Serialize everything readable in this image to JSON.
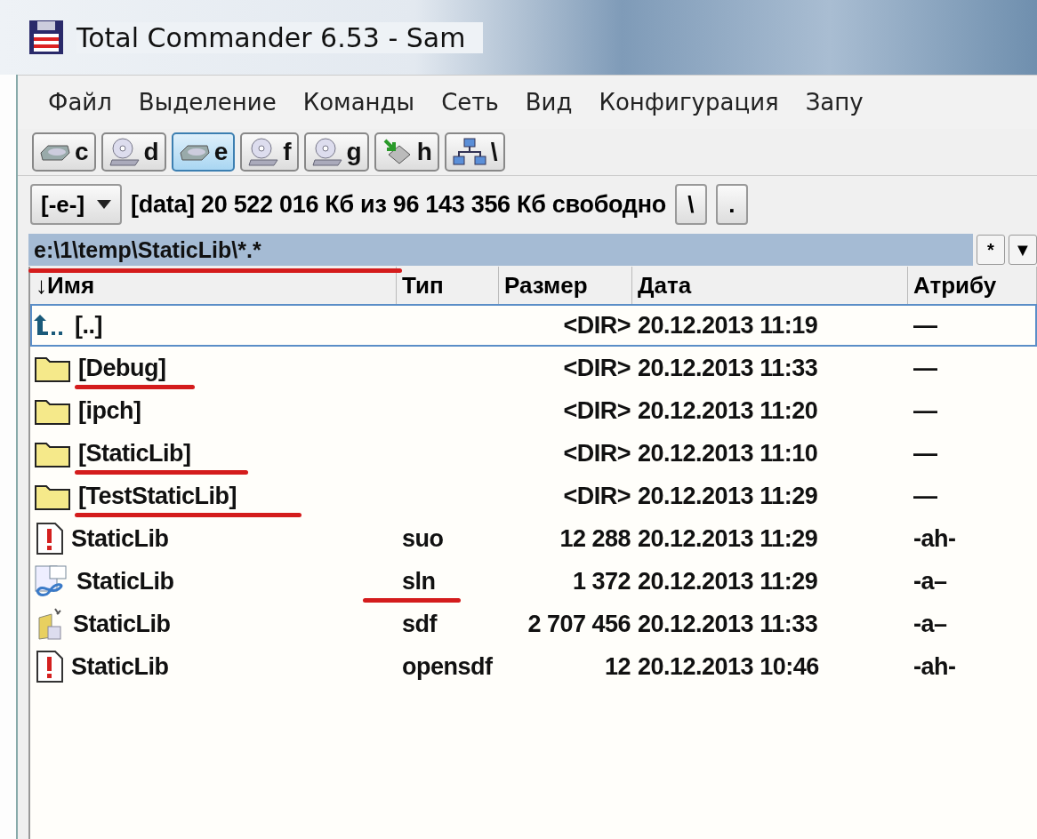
{
  "window": {
    "title": "Total Commander 6.53 - Sam"
  },
  "menu": [
    "Файл",
    "Выделение",
    "Команды",
    "Сеть",
    "Вид",
    "Конфигурация",
    "Запу"
  ],
  "drives": [
    {
      "letter": "c",
      "kind": "disk",
      "selected": false
    },
    {
      "letter": "d",
      "kind": "cd",
      "selected": false
    },
    {
      "letter": "e",
      "kind": "disk",
      "selected": true
    },
    {
      "letter": "f",
      "kind": "cd",
      "selected": false
    },
    {
      "letter": "g",
      "kind": "cd",
      "selected": false
    },
    {
      "letter": "h",
      "kind": "usb",
      "selected": false
    },
    {
      "letter": "\\",
      "kind": "network",
      "selected": false
    }
  ],
  "drive_info": {
    "drive": "[-e-]",
    "text": "[data]  20 522 016 Кб из 96 143 356 Кб свободно",
    "buttons": [
      "\\",
      "."
    ]
  },
  "path": {
    "text": "e:\\1\\temp\\StaticLib\\*.*",
    "annotated": true,
    "buttons": [
      "*",
      "▼"
    ]
  },
  "columns": [
    "↓Имя",
    "Тип",
    "Размер",
    "Дата",
    "Атрибу"
  ],
  "rows": [
    {
      "kind": "up",
      "name": "[..]",
      "type": "",
      "size": "<DIR>",
      "date": "20.12.2013 11:19",
      "attr": "—",
      "selected": true,
      "annotated": false
    },
    {
      "kind": "folder",
      "name": "[Debug]",
      "type": "",
      "size": "<DIR>",
      "date": "20.12.2013 11:33",
      "attr": "—",
      "selected": false,
      "annotated": true
    },
    {
      "kind": "folder",
      "name": "[ipch]",
      "type": "",
      "size": "<DIR>",
      "date": "20.12.2013 11:20",
      "attr": "—",
      "selected": false,
      "annotated": false
    },
    {
      "kind": "folder",
      "name": "[StaticLib]",
      "type": "",
      "size": "<DIR>",
      "date": "20.12.2013 11:10",
      "attr": "—",
      "selected": false,
      "annotated": true
    },
    {
      "kind": "folder",
      "name": "[TestStaticLib]",
      "type": "",
      "size": "<DIR>",
      "date": "20.12.2013 11:29",
      "attr": "—",
      "selected": false,
      "annotated": true
    },
    {
      "kind": "warning",
      "name": "StaticLib",
      "type": "suo",
      "size": "12 288",
      "date": "20.12.2013 11:29",
      "attr": "-ah-",
      "selected": false,
      "annotated": false
    },
    {
      "kind": "solution",
      "name": "StaticLib",
      "type": "sln",
      "size": "1 372",
      "date": "20.12.2013 11:29",
      "attr": "-a–",
      "selected": false,
      "annotated": false,
      "type_annotated": true
    },
    {
      "kind": "database",
      "name": "StaticLib",
      "type": "sdf",
      "size": "2 707 456",
      "date": "20.12.2013 11:33",
      "attr": "-a–",
      "selected": false,
      "annotated": false
    },
    {
      "kind": "warning",
      "name": "StaticLib",
      "type": "opensdf",
      "size": "12",
      "date": "20.12.2013 10:46",
      "attr": "-ah-",
      "selected": false,
      "annotated": false
    }
  ]
}
